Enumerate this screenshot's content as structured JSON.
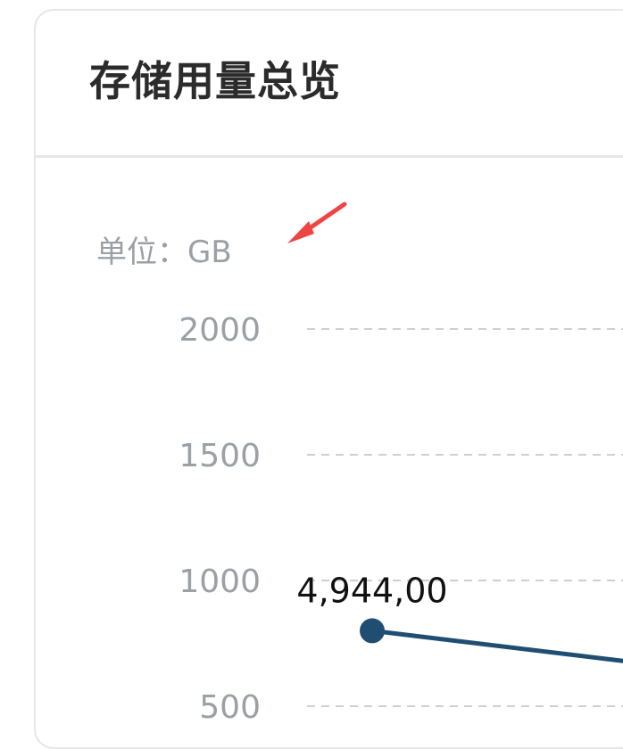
{
  "card": {
    "title": "存储用量总览"
  },
  "chart_data": {
    "type": "line",
    "unit_label": "单位：GB",
    "ylim": [
      500,
      2000
    ],
    "y_ticks": [
      2000,
      1500,
      1000,
      500
    ],
    "grid": true,
    "series": [
      {
        "color": "#1f4e72",
        "points": [
          {
            "y": 800,
            "label": "4,944,00"
          },
          {
            "y": 680
          }
        ]
      }
    ]
  },
  "annotation": {
    "arrow_color": "#ef4444",
    "icon": "red-arrow-icon"
  }
}
